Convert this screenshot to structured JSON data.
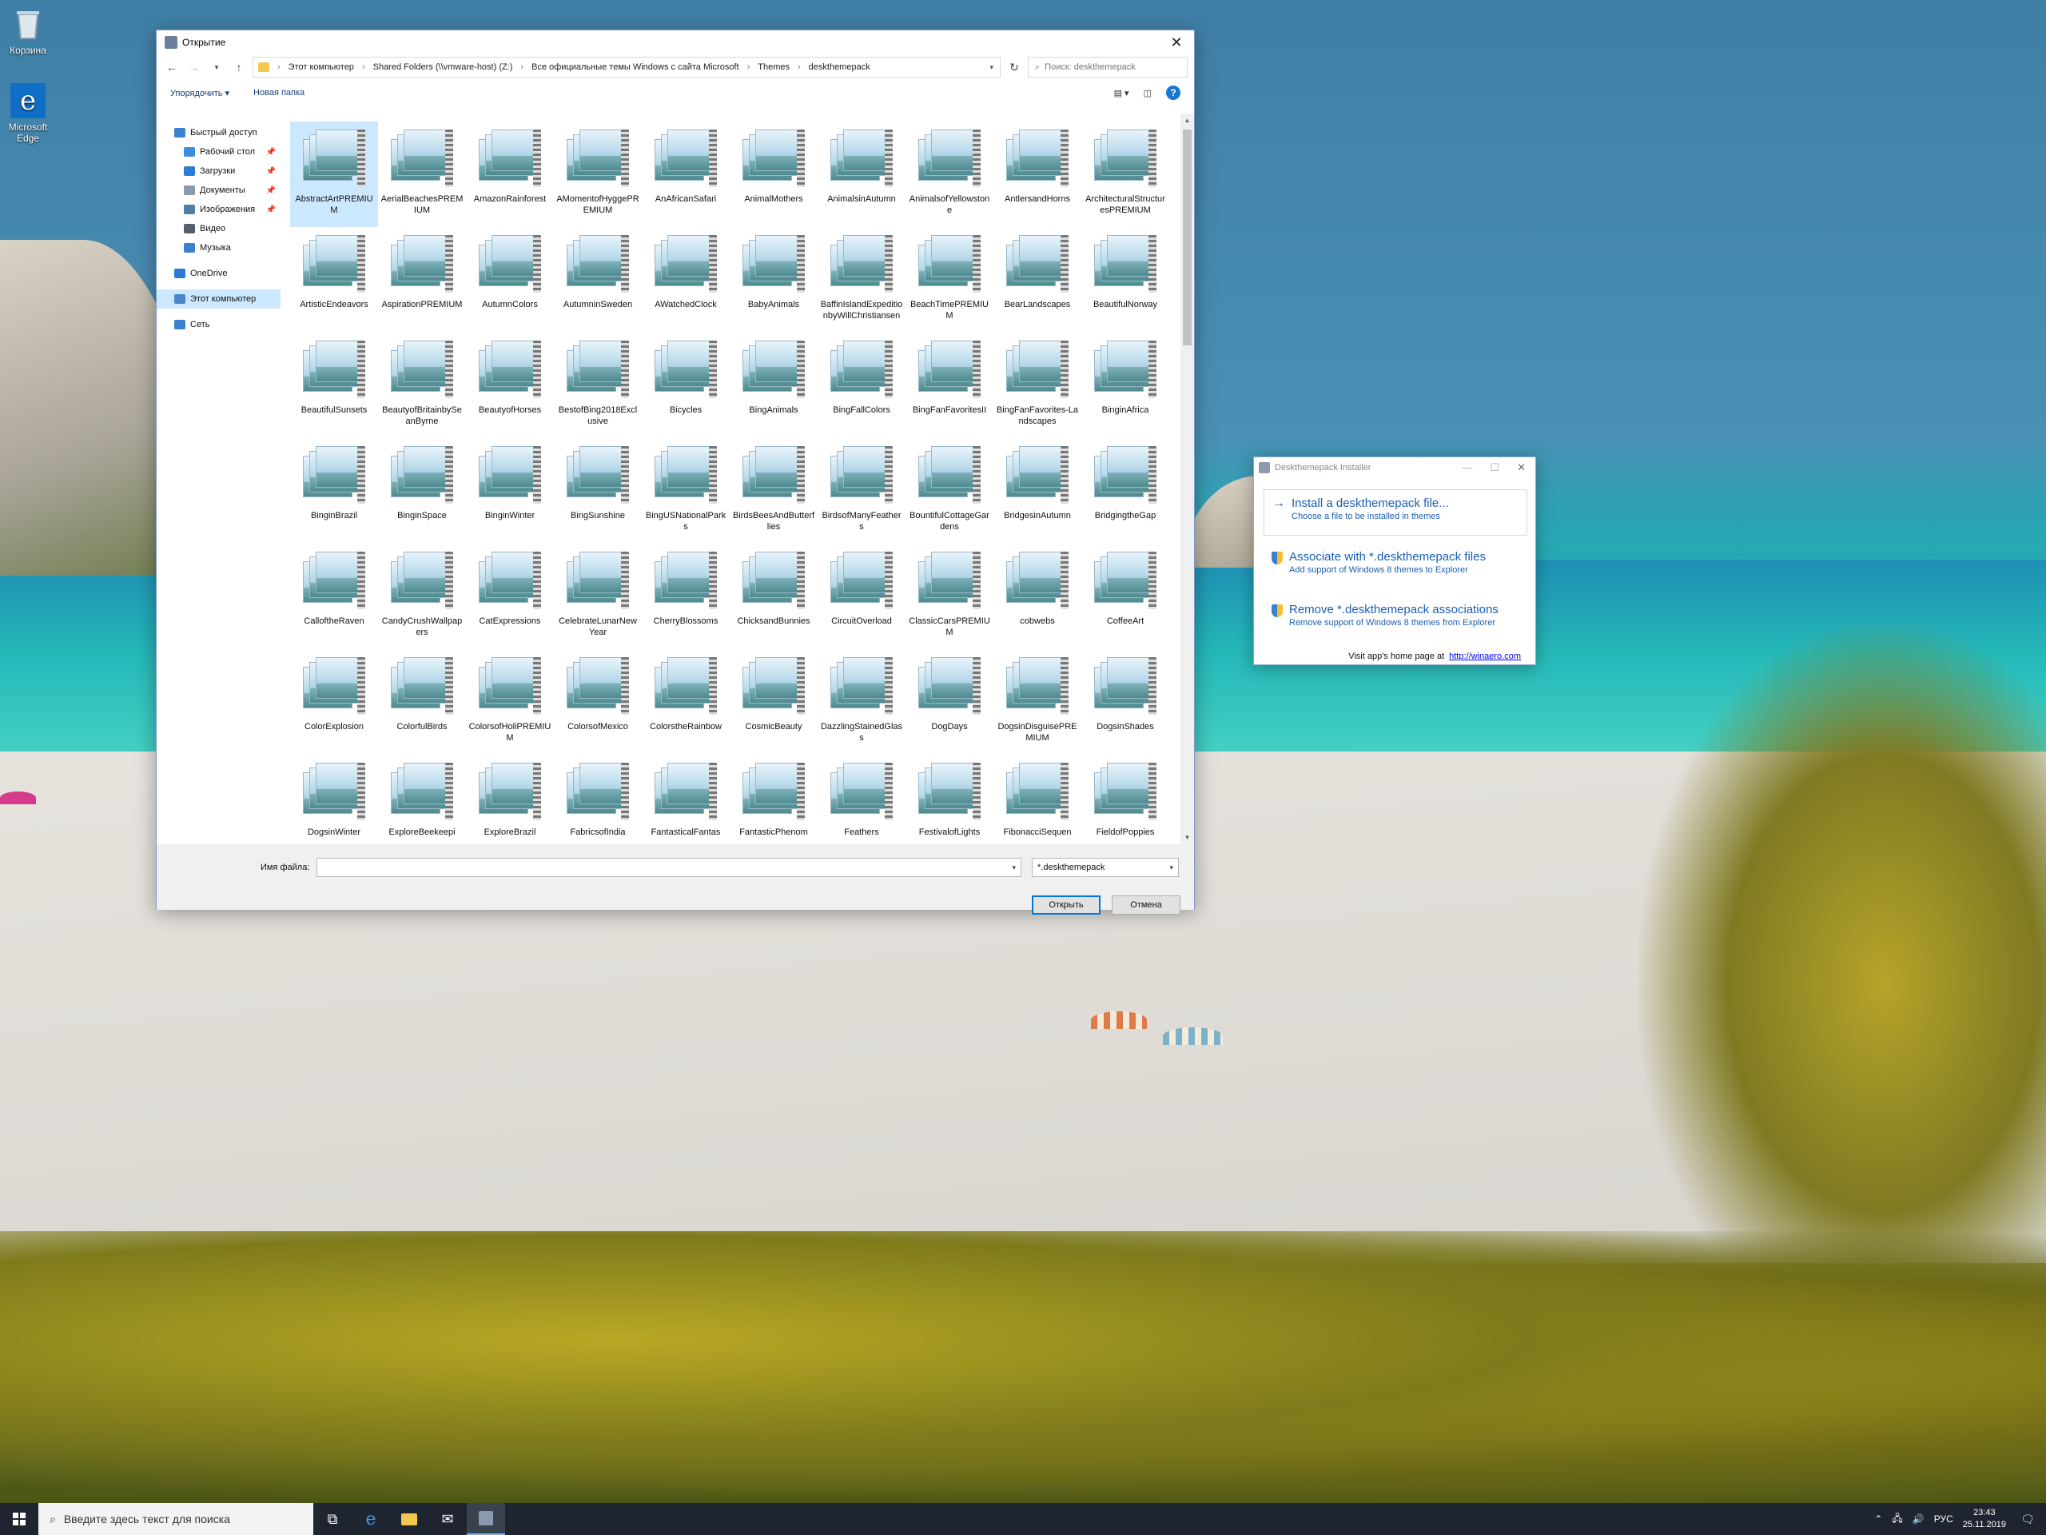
{
  "desktop": {
    "icons": [
      {
        "label": "Корзина",
        "icon": "recycle-bin-icon"
      },
      {
        "label": "Microsoft Edge",
        "icon": "edge-icon"
      }
    ]
  },
  "dialog": {
    "title": "Открытие",
    "breadcrumb": [
      "Этот компьютер",
      "Shared Folders (\\\\vmware-host) (Z:)",
      "Все официальные темы Windows с сайта Microsoft",
      "Themes",
      "deskthemepack"
    ],
    "search_placeholder": "Поиск: deskthemepack",
    "toolbar": {
      "organize": "Упорядочить ▾",
      "new_folder": "Новая папка"
    },
    "nav": [
      {
        "label": "Быстрый доступ",
        "icon": "star-icon",
        "color": "#3b7fd1",
        "child": false,
        "pinned": false
      },
      {
        "label": "Рабочий стол",
        "icon": "desktop-icon",
        "color": "#3b8fe0",
        "child": true,
        "pinned": true
      },
      {
        "label": "Загрузки",
        "icon": "downloads-icon",
        "color": "#2f7bd1",
        "child": true,
        "pinned": true
      },
      {
        "label": "Документы",
        "icon": "documents-icon",
        "color": "#8a9aad",
        "child": true,
        "pinned": true
      },
      {
        "label": "Изображения",
        "icon": "pictures-icon",
        "color": "#4d7ea8",
        "child": true,
        "pinned": true
      },
      {
        "label": "Видео",
        "icon": "videos-icon",
        "color": "#555e6b",
        "child": true,
        "pinned": false
      },
      {
        "label": "Музыка",
        "icon": "music-icon",
        "color": "#3b7fd1",
        "child": true,
        "pinned": false
      },
      {
        "label": "OneDrive",
        "icon": "onedrive-icon",
        "color": "#2a7ad5",
        "child": false,
        "pinned": false
      },
      {
        "label": "Этот компьютер",
        "icon": "this-pc-icon",
        "color": "#4a86c8",
        "child": false,
        "pinned": false
      },
      {
        "label": "Сеть",
        "icon": "network-icon",
        "color": "#3b7fd1",
        "child": false,
        "pinned": false
      }
    ],
    "files": [
      "AbstractArtPREMIUM",
      "AerialBeachesPREMIUM",
      "AmazonRainforest",
      "AMomentofHyggePREMIUM",
      "AnAfricanSafari",
      "AnimalMothers",
      "AnimalsinAutumn",
      "AnimalsofYellowstone",
      "AntlersandHorns",
      "ArchitecturalStructuresPREMIUM",
      "ArtisticEndeavors",
      "AspirationPREMIUM",
      "AutumnColors",
      "AutumninSweden",
      "AWatchedClock",
      "BabyAnimals",
      "BaffinIslandExpeditionbyWillChristiansen",
      "BeachTimePREMIUM",
      "BearLandscapes",
      "BeautifulNorway",
      "BeautifulSunsets",
      "BeautyofBritainbySeanByrne",
      "BeautyofHorses",
      "BestofBing2018Exclusive",
      "Bicycles",
      "BingAnimals",
      "BingFallColors",
      "BingFanFavoritesII",
      "BingFanFavorites-Landscapes",
      "BinginAfrica",
      "BinginBrazil",
      "BinginSpace",
      "BinginWinter",
      "BingSunshine",
      "BingUSNationalParks",
      "BirdsBeesAndButterflies",
      "BirdsofManyFeathers",
      "BountifulCottageGardens",
      "BridgesinAutumn",
      "BridgingtheGap",
      "CalloftheRaven",
      "CandyCrushWallpapers",
      "CatExpressions",
      "CelebrateLunarNewYear",
      "CherryBlossoms",
      "ChicksandBunnies",
      "CircuitOverload",
      "ClassicCarsPREMIUM",
      "cobwebs",
      "CoffeeArt",
      "ColorExplosion",
      "ColorfulBirds",
      "ColorsofHoliPREMIUM",
      "ColorsofMexico",
      "ColorstheRainbow",
      "CosmicBeauty",
      "DazzlingStainedGlass",
      "DogDays",
      "DogsinDisguisePREMIUM",
      "DogsinShades",
      "DogsinWinter",
      "ExploreBeekeepi",
      "ExploreBrazil",
      "FabricsofIndia",
      "FantasticalFantas",
      "FantasticPhenom",
      "Feathers",
      "FestivalofLights",
      "FibonacciSequen",
      "FieldofPoppies"
    ],
    "selected_file": "AbstractArtPREMIUM",
    "filename_label": "Имя файла:",
    "filename_value": "",
    "filetype_value": "*.deskthemepack",
    "open_button": "Открыть",
    "cancel_button": "Отмена"
  },
  "installer": {
    "title": "Deskthemepack Installer",
    "commands": [
      {
        "main": "Install a deskthemepack file...",
        "sub": "Choose a file to be installed in themes",
        "icon": "arrow-right-icon"
      },
      {
        "main": "Associate with *.deskthemepack files",
        "sub": "Add support of Windows 8 themes to Explorer",
        "icon": "shield-icon"
      },
      {
        "main": "Remove *.deskthemepack associations",
        "sub": "Remove support of Windows 8 themes from Explorer",
        "icon": "shield-icon"
      }
    ],
    "visit_text": "Visit app's home page at",
    "visit_link": "http://winaero.com"
  },
  "taskbar": {
    "search_placeholder": "Введите здесь текст для поиска",
    "language": "РУС",
    "time": "23:43",
    "date": "25.11.2019"
  },
  "colors": {
    "accent": "#0078d7",
    "selection": "#cce8ff",
    "link": "#1a5fb4"
  }
}
